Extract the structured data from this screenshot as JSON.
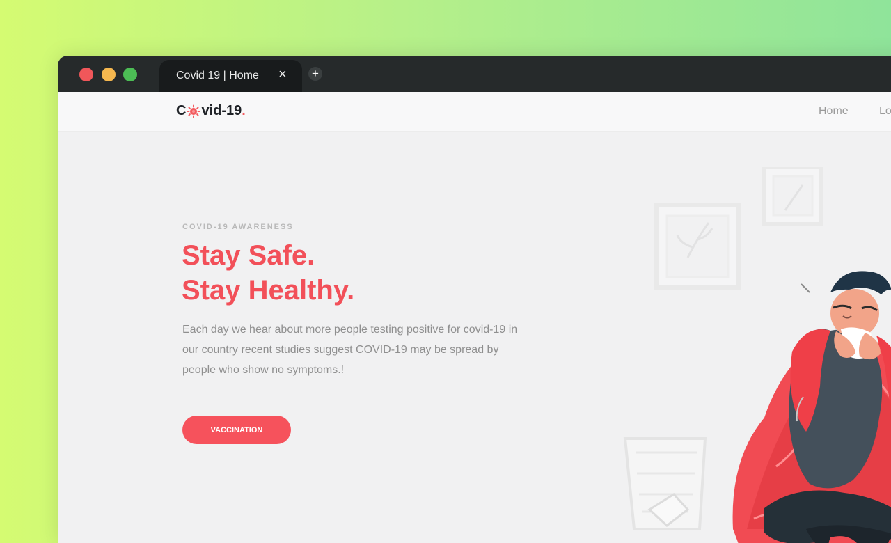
{
  "browser": {
    "tab_title": "Covid 19 | Home",
    "close_symbol": "×",
    "new_tab_symbol": "+",
    "window_controls": {
      "close": "#f0575a",
      "minimize": "#f6b84f",
      "maximize": "#4cbd55"
    }
  },
  "site": {
    "logo": {
      "prefix": "C",
      "suffix": "vid-19",
      "dot": ".",
      "icon": "virus-icon"
    },
    "nav": {
      "home": "Home",
      "partial": "Lo"
    }
  },
  "hero": {
    "eyebrow": "COVID-19 AWARENESS",
    "title_line_1": "Stay Safe.",
    "title_line_2": "Stay Healthy.",
    "copy_line_1": "Each day we hear about more people testing positive for covid-19 in",
    "copy_line_2": "our country recent studies suggest COVID-19 may be spread by",
    "copy_line_3": "people who show no symptoms.!",
    "button_label": "VACCINATION",
    "accent_color": "#f25059"
  },
  "illustration": {
    "name": "sick-person-illustration"
  }
}
